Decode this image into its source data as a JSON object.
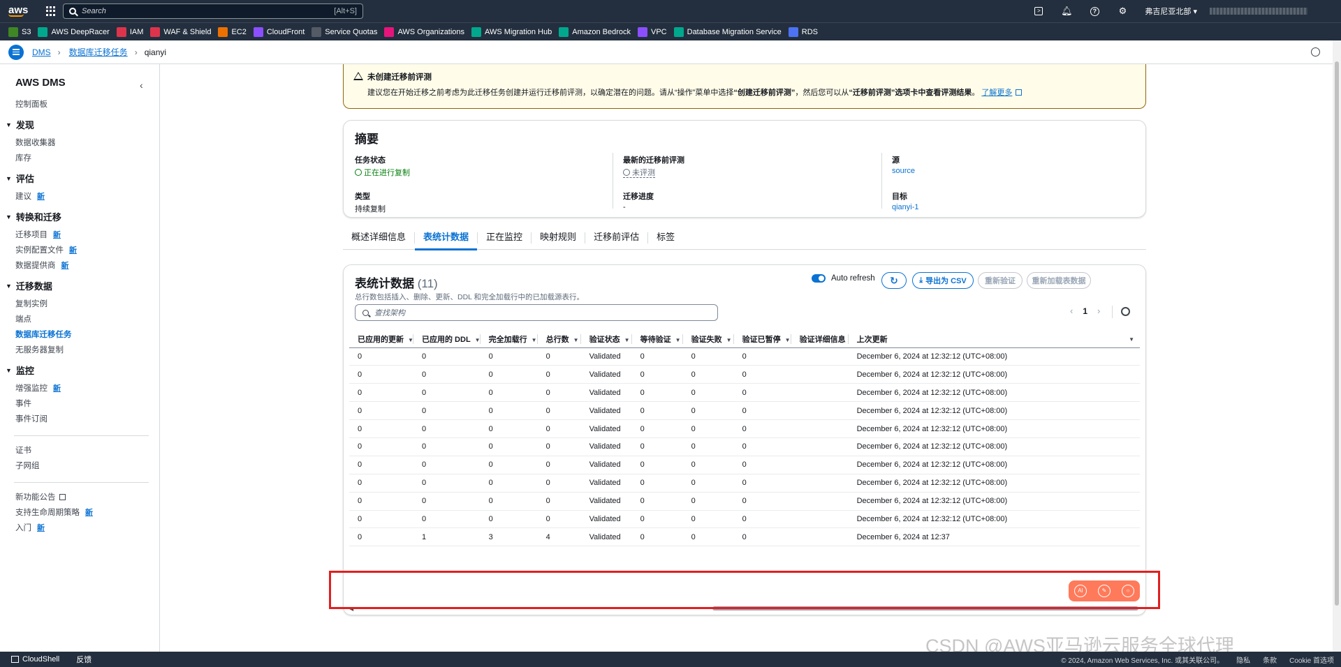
{
  "topbar": {
    "search_placeholder": "Search",
    "search_shortcut": "[Alt+S]",
    "region": "弗吉尼亚北部 ▾"
  },
  "favorites": [
    {
      "label": "S3",
      "color": "#3f8624"
    },
    {
      "label": "AWS DeepRacer",
      "color": "#01a88d"
    },
    {
      "label": "IAM",
      "color": "#dd344c"
    },
    {
      "label": "WAF & Shield",
      "color": "#dd344c"
    },
    {
      "label": "EC2",
      "color": "#ed7100"
    },
    {
      "label": "CloudFront",
      "color": "#8c4fff"
    },
    {
      "label": "Service Quotas",
      "color": "#545b64"
    },
    {
      "label": "AWS Organizations",
      "color": "#e7157b"
    },
    {
      "label": "AWS Migration Hub",
      "color": "#01a88d"
    },
    {
      "label": "Amazon Bedrock",
      "color": "#01a88d"
    },
    {
      "label": "VPC",
      "color": "#8c4fff"
    },
    {
      "label": "Database Migration Service",
      "color": "#01a88d"
    },
    {
      "label": "RDS",
      "color": "#4d72f3"
    }
  ],
  "breadcrumb": {
    "root": "DMS",
    "parent": "数据库迁移任务",
    "current": "qianyi"
  },
  "sidebar": {
    "title": "AWS DMS",
    "dashboard": "控制面板",
    "new_label": "新",
    "sections": [
      {
        "title": "发现",
        "items": [
          {
            "label": "数据收集器"
          },
          {
            "label": "库存"
          }
        ]
      },
      {
        "title": "评估",
        "items": [
          {
            "label": "建议",
            "new": true
          }
        ]
      },
      {
        "title": "转换和迁移",
        "items": [
          {
            "label": "迁移项目",
            "new": true
          },
          {
            "label": "实例配置文件",
            "new": true
          },
          {
            "label": "数据提供商",
            "new": true
          }
        ]
      },
      {
        "title": "迁移数据",
        "items": [
          {
            "label": "复制实例"
          },
          {
            "label": "端点"
          },
          {
            "label": "数据库迁移任务",
            "active": true
          },
          {
            "label": "无服务器复制"
          }
        ]
      },
      {
        "title": "监控",
        "items": [
          {
            "label": "增强监控",
            "new": true
          },
          {
            "label": "事件"
          },
          {
            "label": "事件订阅"
          }
        ]
      }
    ],
    "misc": [
      "证书",
      "子网组"
    ],
    "footer": [
      "新功能公告",
      "支持生命周期策略",
      "入门"
    ]
  },
  "alert": {
    "title": "未创建迁移前评测",
    "body_pre": "建议您在开始迁移之前考虑为此迁移任务创建并运行迁移前评测，以确定潜在的问题。请从“操作”菜单中选择",
    "body_bold1": "“创建迁移前评测”",
    "body_mid": "，然后您可以从",
    "body_bold2": "“迁移前评测”选项卡中查看评测结果",
    "body_end": "。",
    "link": "了解更多"
  },
  "summary": {
    "title": "摘要",
    "status_label": "任务状态",
    "status_value": "正在进行复制",
    "type_label": "类型",
    "type_value": "持续复制",
    "assessment_label": "最新的迁移前评测",
    "assessment_value": "未评测",
    "progress_label": "迁移进度",
    "progress_value": "-",
    "source_label": "源",
    "source_value": "source",
    "target_label": "目标",
    "target_value": "qianyi-1"
  },
  "tabs": [
    "概述详细信息",
    "表统计数据",
    "正在监控",
    "映射规则",
    "迁移前评估",
    "标签"
  ],
  "table_card": {
    "title": "表统计数据",
    "count": "(11)",
    "description": "总行数包括插入、删除、更新、DDL 和完全加载行中的已加载源表行。",
    "auto_refresh": "Auto refresh",
    "export_csv": "导出为 CSV",
    "revalidate": "重新验证",
    "reload": "重新加载表数据",
    "filter_placeholder": "查找架构",
    "page": "1"
  },
  "columns": [
    "已应用的更新",
    "已应用的 DDL",
    "完全加载行",
    "总行数",
    "验证状态",
    "等待验证",
    "验证失败",
    "验证已暂停",
    "验证详细信息",
    "上次更新"
  ],
  "rows": [
    [
      "0",
      "0",
      "0",
      "0",
      "Validated",
      "0",
      "0",
      "0",
      "",
      "December 6, 2024 at 12:32:12 (UTC+08:00)"
    ],
    [
      "0",
      "0",
      "0",
      "0",
      "Validated",
      "0",
      "0",
      "0",
      "",
      "December 6, 2024 at 12:32:12 (UTC+08:00)"
    ],
    [
      "0",
      "0",
      "0",
      "0",
      "Validated",
      "0",
      "0",
      "0",
      "",
      "December 6, 2024 at 12:32:12 (UTC+08:00)"
    ],
    [
      "0",
      "0",
      "0",
      "0",
      "Validated",
      "0",
      "0",
      "0",
      "",
      "December 6, 2024 at 12:32:12 (UTC+08:00)"
    ],
    [
      "0",
      "0",
      "0",
      "0",
      "Validated",
      "0",
      "0",
      "0",
      "",
      "December 6, 2024 at 12:32:12 (UTC+08:00)"
    ],
    [
      "0",
      "0",
      "0",
      "0",
      "Validated",
      "0",
      "0",
      "0",
      "",
      "December 6, 2024 at 12:32:12 (UTC+08:00)"
    ],
    [
      "0",
      "0",
      "0",
      "0",
      "Validated",
      "0",
      "0",
      "0",
      "",
      "December 6, 2024 at 12:32:12 (UTC+08:00)"
    ],
    [
      "0",
      "0",
      "0",
      "0",
      "Validated",
      "0",
      "0",
      "0",
      "",
      "December 6, 2024 at 12:32:12 (UTC+08:00)"
    ],
    [
      "0",
      "0",
      "0",
      "0",
      "Validated",
      "0",
      "0",
      "0",
      "",
      "December 6, 2024 at 12:32:12 (UTC+08:00)"
    ],
    [
      "0",
      "0",
      "0",
      "0",
      "Validated",
      "0",
      "0",
      "0",
      "",
      "December 6, 2024 at 12:32:12 (UTC+08:00)"
    ],
    [
      "0",
      "1",
      "3",
      "4",
      "Validated",
      "0",
      "0",
      "0",
      "",
      "December 6, 2024 at 12:37"
    ]
  ],
  "bottombar": {
    "cloudshell": "CloudShell",
    "feedback": "反馈",
    "copyright": "© 2024, Amazon Web Services, Inc. 或其关联公司。",
    "privacy": "隐私",
    "terms": "条款",
    "cookie": "Cookie 首选项"
  },
  "watermark": "CSDN @AWS亚马逊云服务全球代理"
}
